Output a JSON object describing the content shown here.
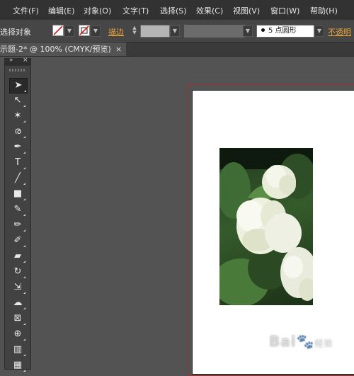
{
  "menubar": {
    "items": [
      "文件(F)",
      "编辑(E)",
      "对象(O)",
      "文字(T)",
      "选择(S)",
      "效果(C)",
      "视图(V)",
      "窗口(W)",
      "帮助(H)"
    ]
  },
  "control_bar": {
    "selection_label": "选择对象",
    "stroke_label": "描边",
    "brush_label": "5 点圆形",
    "opacity_label": "不透明",
    "accent_color": "#e8a33d"
  },
  "document": {
    "tab_title": "示题-2* @ 100% (CMYK/预览)",
    "close_symbol": "×"
  },
  "toolbar": {
    "collapse_symbol": "»",
    "close_symbol": "×",
    "tools": [
      {
        "name": "selection-tool",
        "glyph": "➤",
        "active": true
      },
      {
        "name": "direct-selection-tool",
        "glyph": "↖"
      },
      {
        "name": "magic-wand-tool",
        "glyph": "✶"
      },
      {
        "name": "lasso-tool",
        "glyph": "ര"
      },
      {
        "name": "pen-tool",
        "glyph": "✒"
      },
      {
        "name": "type-tool",
        "glyph": "T"
      },
      {
        "name": "line-tool",
        "glyph": "╱"
      },
      {
        "name": "rectangle-tool",
        "glyph": "■"
      },
      {
        "name": "paintbrush-tool",
        "glyph": "✎"
      },
      {
        "name": "pencil-tool",
        "glyph": "✏"
      },
      {
        "name": "blob-brush-tool",
        "glyph": "✐"
      },
      {
        "name": "eraser-tool",
        "glyph": "▰"
      },
      {
        "name": "rotate-tool",
        "glyph": "↻"
      },
      {
        "name": "scale-tool",
        "glyph": "⇲"
      },
      {
        "name": "warp-tool",
        "glyph": "☁"
      },
      {
        "name": "free-transform-tool",
        "glyph": "⊠"
      },
      {
        "name": "shape-builder-tool",
        "glyph": "⊕"
      },
      {
        "name": "graph-tool",
        "glyph": "▥"
      },
      {
        "name": "mesh-tool",
        "glyph": "▦"
      }
    ]
  },
  "watermark": {
    "brand": "Bai",
    "suffix": "经验"
  }
}
